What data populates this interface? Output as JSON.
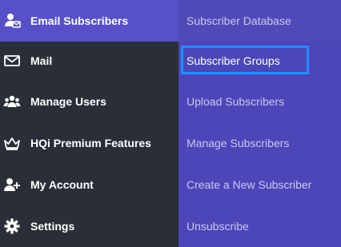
{
  "left_menu": {
    "items": [
      {
        "label": "Email Subscribers",
        "icon": "users-mail-icon",
        "active": true
      },
      {
        "label": "Mail",
        "icon": "envelope-icon"
      },
      {
        "label": "Manage Users",
        "icon": "users-group-icon"
      },
      {
        "label": "HQi Premium Features",
        "icon": "crown-icon"
      },
      {
        "label": "My Account",
        "icon": "user-plus-icon"
      },
      {
        "label": "Settings",
        "icon": "gear-icon"
      }
    ]
  },
  "sub_menu": {
    "items": [
      {
        "label": "Subscriber Database"
      },
      {
        "label": "Subscriber Groups",
        "selected": true
      },
      {
        "label": "Upload Subscribers"
      },
      {
        "label": "Manage Subscribers"
      },
      {
        "label": "Create a New Subscriber"
      },
      {
        "label": "Unsubscribe"
      }
    ]
  },
  "colors": {
    "left_bg": "#2a2e37",
    "active_bg": "#5750c8",
    "submenu_bg": "#4c46b8",
    "focus_border": "#1f8fff"
  }
}
